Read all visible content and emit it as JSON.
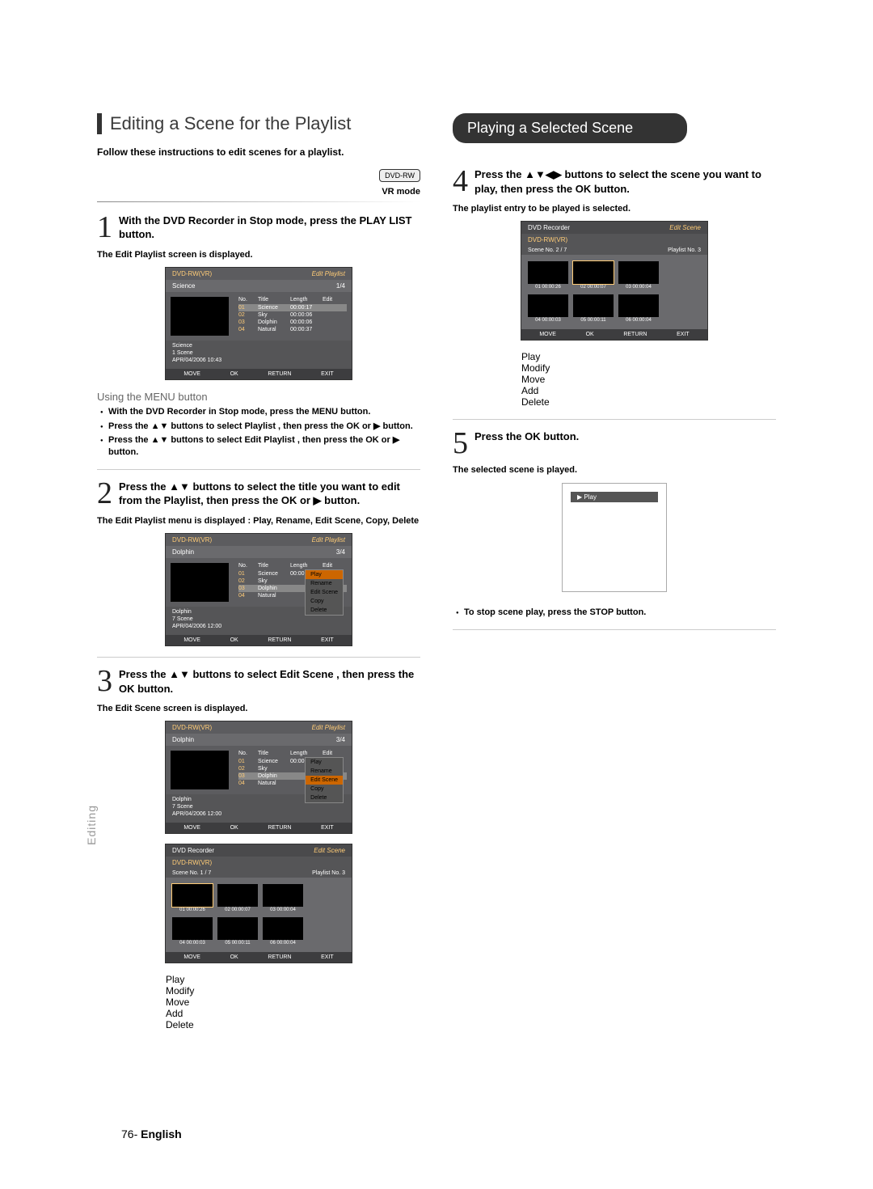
{
  "section_title": "Editing a Scene for the Playlist",
  "lead": "Follow these instructions to edit scenes for a playlist.",
  "dvd_badge": "DVD-RW",
  "vr_mode": "VR mode",
  "side_tab": "Editing",
  "footer": {
    "page": "76-",
    "lang": "English"
  },
  "step1": {
    "text": "With the DVD Recorder in Stop mode, press the PLAY LIST button.",
    "note": "The Edit Playlist screen is displayed."
  },
  "menu_heading": "Using the MENU button",
  "menu_bullets": {
    "b1": "With the DVD Recorder in Stop mode, press the MENU button.",
    "b2": "Press the ▲▼ buttons to select Playlist , then press the OK or ▶ button.",
    "b3": "Press the ▲▼ buttons to select Edit Playlist , then press the OK or ▶ button."
  },
  "step2": {
    "text": "Press the ▲▼ buttons to select the title you want to edit from the Playlist, then press the OK or ▶ button.",
    "note": "The Edit Playlist menu is displayed : Play, Rename, Edit Scene, Copy, Delete"
  },
  "step3": {
    "text": "Press the ▲▼ buttons to select Edit Scene , then press the OK button.",
    "note": "The Edit Scene screen is displayed."
  },
  "pill": "Playing a Selected Scene",
  "step4": {
    "text": "Press the ▲▼◀▶ buttons to select the scene you want to play, then press the OK button.",
    "note": "The playlist entry to be played is selected."
  },
  "step5": {
    "text": "Press the OK button.",
    "note": "The selected scene is played."
  },
  "stop_bullet": "To stop scene play, press the STOP button.",
  "mock1": {
    "device": "DVD-RW(VR)",
    "screen": "Edit Playlist",
    "title": "Science",
    "frac": "1/4",
    "cols": [
      "No.",
      "Title",
      "Length",
      "Edit"
    ],
    "rows": [
      [
        "01",
        "Science",
        "00:00:17",
        ""
      ],
      [
        "02",
        "Sky",
        "00:00:06",
        ""
      ],
      [
        "03",
        "Dolphin",
        "00:00:06",
        ""
      ],
      [
        "04",
        "Natural",
        "00:00:37",
        ""
      ]
    ],
    "info": [
      "Science",
      "1 Scene",
      "APR/04/2006 10:43"
    ],
    "legend": [
      "MOVE",
      "OK",
      "RETURN",
      "EXIT"
    ]
  },
  "mock2": {
    "device": "DVD-RW(VR)",
    "screen": "Edit Playlist",
    "title": "Dolphin",
    "frac": "3/4",
    "rows": [
      [
        "01",
        "Science",
        "00:00:17",
        ""
      ],
      [
        "02",
        "Sky",
        "",
        ""
      ],
      [
        "03",
        "Dolphin",
        "",
        ""
      ],
      [
        "04",
        "Natural",
        "",
        ""
      ]
    ],
    "info": [
      "Dolphin",
      "7 Scene",
      "APR/04/2006 12:00"
    ],
    "ctx_sel": "Play",
    "ctx": [
      "Play",
      "Rename",
      "Edit Scene",
      "Copy",
      "Delete"
    ]
  },
  "mock3": {
    "ctx_sel": "Edit Scene"
  },
  "scene1": {
    "top": "DVD Recorder",
    "screen": "Edit Scene",
    "device": "DVD-RW(VR)",
    "scene_no": "Scene No.   1 / 7",
    "plno": "Playlist No.  3",
    "cells": [
      {
        "n": "01",
        "t": "00:00:26"
      },
      {
        "n": "02",
        "t": "00:00:07"
      },
      {
        "n": "03",
        "t": "00:00:04"
      },
      {
        "n": "04",
        "t": "00:00:03"
      },
      {
        "n": "05",
        "t": "00:00:11"
      },
      {
        "n": "06",
        "t": "00:00:04"
      }
    ],
    "side": [
      "Play",
      "Modify",
      "Move",
      "Add",
      "Delete"
    ],
    "legend": [
      "MOVE",
      "OK",
      "RETURN",
      "EXIT"
    ]
  },
  "scene2": {
    "scene_no": "Scene No.   2 / 7",
    "sel": "Play"
  },
  "play_box": "Play"
}
